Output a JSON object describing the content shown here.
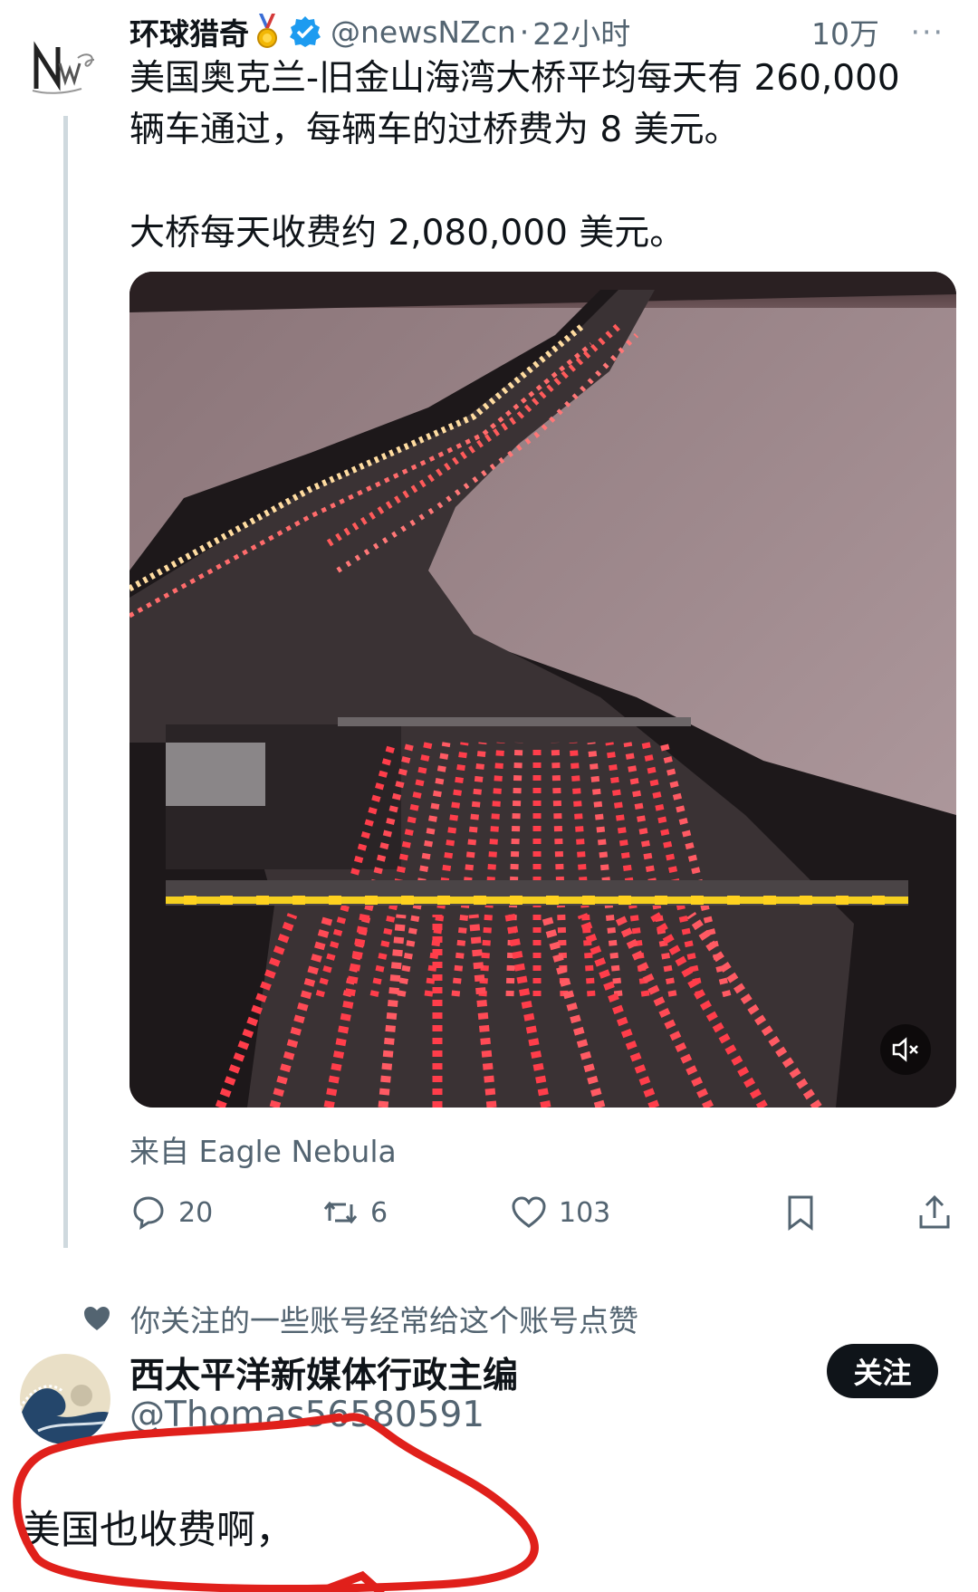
{
  "tweet": {
    "author_name": "环球猎奇",
    "author_handle": "@newsNZcn",
    "separator": "·",
    "time": "22小时",
    "views": "10万",
    "more": "···",
    "text": "美国奥克兰-旧金山海湾大桥平均每天有 260,000\n辆车通过，每辆车的过桥费为 8 美元。\n\n大桥每天收费约 2,080,000 美元。",
    "source": "来自 Eagle Nebula",
    "replies": "20",
    "retweets": "6",
    "likes": "103"
  },
  "social_context": "你关注的一些账号经常给这个账号点赞",
  "reply": {
    "author_name": "西太平洋新媒体行政主编",
    "author_handle": "@Thomas56580591",
    "follow_label": "关注",
    "text": "美国也收费啊，"
  },
  "icons": {
    "medal": "medal-icon",
    "verified": "verified-badge-icon",
    "reply": "reply-icon",
    "retweet": "retweet-icon",
    "like": "heart-icon",
    "bookmark": "bookmark-icon",
    "share": "share-icon",
    "mute": "mute-icon"
  },
  "colors": {
    "verified": "#1d9bf0",
    "annotation": "#e0201b",
    "secondary_text": "#536471"
  }
}
